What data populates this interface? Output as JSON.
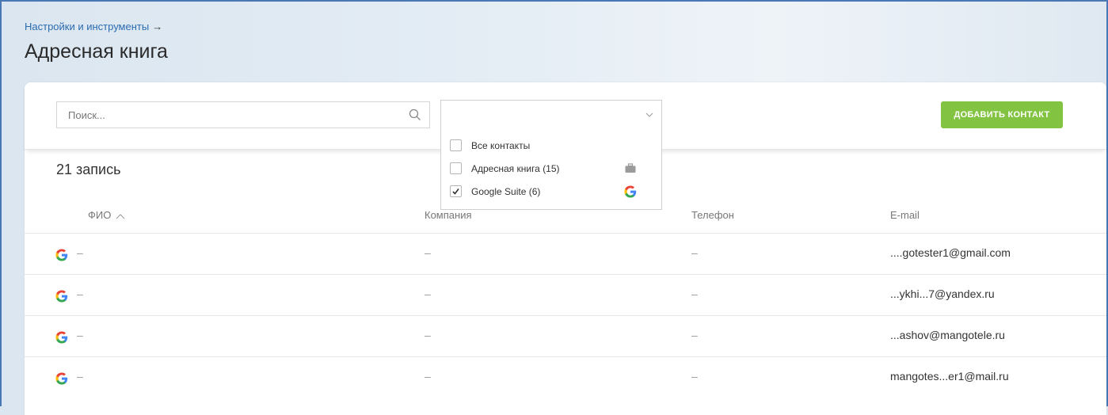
{
  "breadcrumb": {
    "parent": "Настройки и инструменты",
    "arrow": "→"
  },
  "page": {
    "title": "Адресная книга"
  },
  "search": {
    "placeholder": "Поиск..."
  },
  "source_filter": {
    "selected_value": "",
    "options": [
      {
        "label": "Все контакты",
        "checked": false,
        "icon": ""
      },
      {
        "label": "Адресная книга (15)",
        "checked": false,
        "icon": "briefcase-icon"
      },
      {
        "label": "Google Suite (6)",
        "checked": true,
        "icon": "google-icon"
      }
    ]
  },
  "toolbar": {
    "add_contact_label": "ДОБАВИТЬ КОНТАКТ"
  },
  "list": {
    "record_count": "21 запись",
    "columns": {
      "name": "ФИО",
      "company": "Компания",
      "phone": "Телефон",
      "email": "E-mail"
    },
    "sort": {
      "column": "name",
      "direction": "asc"
    },
    "rows": [
      {
        "source": "google-icon",
        "name": "–",
        "company": "–",
        "phone": "–",
        "email": "....gotester1@gmail.com"
      },
      {
        "source": "google-icon",
        "name": "–",
        "company": "–",
        "phone": "–",
        "email": "...ykhi...7@yandex.ru"
      },
      {
        "source": "google-icon",
        "name": "–",
        "company": "–",
        "phone": "–",
        "email": "...ashov@mangotele.ru"
      },
      {
        "source": "google-icon",
        "name": "–",
        "company": "–",
        "phone": "–",
        "email": "mangotes...er1@mail.ru"
      }
    ]
  },
  "colors": {
    "accent_green": "#82c341",
    "link_blue": "#2b6cb0",
    "frame_blue": "#4a78b5"
  }
}
